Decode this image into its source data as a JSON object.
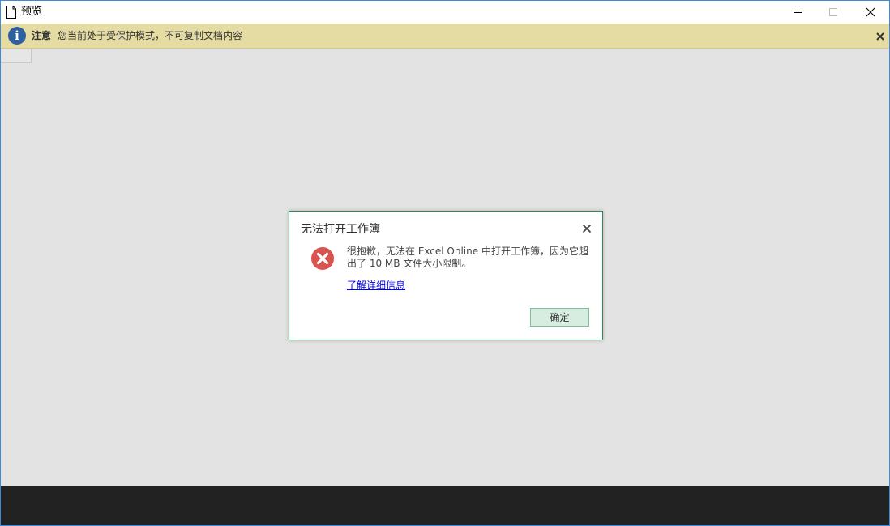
{
  "window": {
    "title": "预览"
  },
  "infobar": {
    "label": "注意",
    "message": "您当前处于受保护模式，不可复制文档内容",
    "icon": "info-icon",
    "color": "#e5dca3"
  },
  "dialog": {
    "title": "无法打开工作簿",
    "message": "很抱歉，无法在 Excel Online 中打开工作簿，因为它超出了 10 MB 文件大小限制。",
    "link": "了解详细信息",
    "ok_label": "确定",
    "error_icon": "error-icon",
    "accent": "#2f8a55"
  },
  "colors": {
    "content_bg": "#e3e3e3",
    "footer_bg": "#222222",
    "error_red": "#d9534f"
  }
}
